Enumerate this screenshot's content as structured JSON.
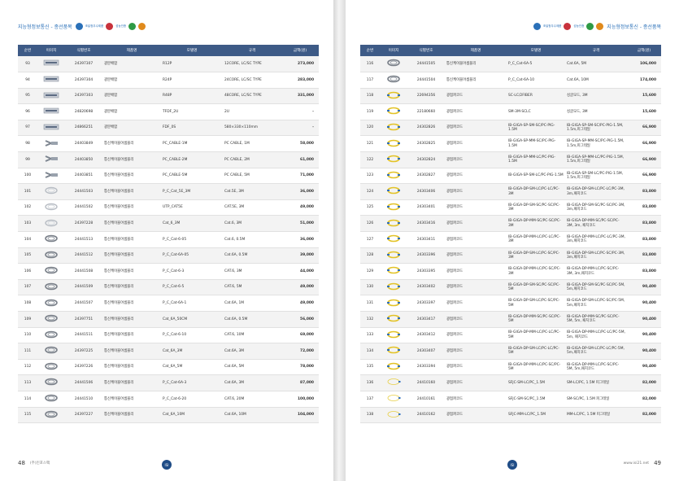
{
  "left": {
    "header_title": "지능형정보통신 - 종선품목",
    "logos": [
      {
        "name": "blue-logo",
        "color": "#2a70b8",
        "text": "조달청우수제품"
      },
      {
        "name": "red-blue-logo",
        "color": "#c8323c",
        "text": "성능인증"
      },
      {
        "name": "green-logo",
        "color": "#2f9a45",
        "text": ""
      },
      {
        "name": "orange-logo",
        "color": "#e08a1c",
        "text": ""
      }
    ],
    "columns": [
      "순번",
      "이미지",
      "식별번호",
      "제품명",
      "모델명",
      "규격",
      "금액(원)"
    ],
    "rows": [
      {
        "no": "93",
        "img": "rack",
        "code": "24397307",
        "name": "광분배함",
        "model": "R12P",
        "spec": "12CORE, LC/SC TYPE",
        "price": "273,000"
      },
      {
        "no": "94",
        "img": "rack",
        "code": "24397304",
        "name": "광분배함",
        "model": "R24P",
        "spec": "24CORE, LC/SC TYPE",
        "price": "283,000"
      },
      {
        "no": "95",
        "img": "rack",
        "code": "24397303",
        "name": "광분배함",
        "model": "R48P",
        "spec": "48CORE, LC/SC TYPE",
        "price": "331,000"
      },
      {
        "no": "96",
        "img": "rack",
        "code": "24820698",
        "name": "광분배함",
        "model": "TFDF_2U",
        "spec": "2U",
        "price": "-"
      },
      {
        "no": "97",
        "img": "rack",
        "code": "24866251",
        "name": "광분배함",
        "model": "FDF_0S",
        "spec": "580×330×110mm",
        "price": "-"
      },
      {
        "no": "98",
        "img": "gray-cable",
        "code": "24403849",
        "name": "통신케이블어셈블리",
        "model": "PC_CABLE-1M",
        "spec": "PC CABLE, 1M",
        "price": "58,000"
      },
      {
        "no": "99",
        "img": "gray-cable",
        "code": "24403850",
        "name": "통신케이블어셈블리",
        "model": "PC_CABLE-2M",
        "spec": "PC CABLE, 2M",
        "price": "61,000"
      },
      {
        "no": "100",
        "img": "gray-cable",
        "code": "24403851",
        "name": "통신케이블어셈블리",
        "model": "PC_CABLE-5M",
        "spec": "PC CABLE, 5M",
        "price": "71,000"
      },
      {
        "no": "101",
        "img": "white-coil",
        "code": "24441503",
        "name": "통신케이블어셈블리",
        "model": "P_C_Cat_5E_3M",
        "spec": "Cat.5E, 3M",
        "price": "36,000"
      },
      {
        "no": "102",
        "img": "white-coil",
        "code": "24441502",
        "name": "통신케이블어셈블리",
        "model": "UTP_CAT5E",
        "spec": "CAT.5E, 3M",
        "price": "49,000"
      },
      {
        "no": "103",
        "img": "white-coil",
        "code": "24397228",
        "name": "통신케이블어셈블리",
        "model": "Cat_6_3M",
        "spec": "Cat.6, 3M",
        "price": "51,000"
      },
      {
        "no": "104",
        "img": "gray-coil",
        "code": "24441513",
        "name": "통신케이블어셈블리",
        "model": "P_C_Cat-6-05",
        "spec": "Cat.6, 0.5M",
        "price": "36,000"
      },
      {
        "no": "105",
        "img": "gray-coil",
        "code": "24441512",
        "name": "통신케이블어셈블리",
        "model": "P_C_Cat-6A-05",
        "spec": "Cat.6A, 0.5M",
        "price": "39,000"
      },
      {
        "no": "106",
        "img": "gray-coil",
        "code": "24441508",
        "name": "통신케이블어셈블리",
        "model": "P_C_Cat-6-3",
        "spec": "CAT.6, 3M",
        "price": "44,000"
      },
      {
        "no": "107",
        "img": "gray-coil",
        "code": "24441509",
        "name": "통신케이블어셈블리",
        "model": "P_C_Cat-6-5",
        "spec": "CAT.6, 5M",
        "price": "49,000"
      },
      {
        "no": "108",
        "img": "gray-coil",
        "code": "24441507",
        "name": "통신케이블어셈블리",
        "model": "P_C_Cat-6A-1",
        "spec": "Cat.6A, 1M",
        "price": "49,000"
      },
      {
        "no": "109",
        "img": "gray-coil",
        "code": "24397751",
        "name": "통신케이블어셈블리",
        "model": "Cat_6A_50CM",
        "spec": "Cat.6A, 0.5M",
        "price": "56,000"
      },
      {
        "no": "110",
        "img": "gray-coil",
        "code": "24441511",
        "name": "통신케이블어셈블리",
        "model": "P_C_Cat-6-10",
        "spec": "CAT.6, 10M",
        "price": "69,000"
      },
      {
        "no": "111",
        "img": "gray-coil",
        "code": "24397225",
        "name": "통신케이블어셈블리",
        "model": "Cat_6A_3M",
        "spec": "Cat.6A, 3M",
        "price": "72,000"
      },
      {
        "no": "112",
        "img": "gray-coil",
        "code": "24397226",
        "name": "통신케이블어셈블리",
        "model": "Cat_6A_5M",
        "spec": "Cat.6A, 5M",
        "price": "78,000"
      },
      {
        "no": "113",
        "img": "gray-coil",
        "code": "24441506",
        "name": "통신케이블어셈블리",
        "model": "P_C_Cat-6A-3",
        "spec": "Cat.6A, 3M",
        "price": "87,000"
      },
      {
        "no": "114",
        "img": "gray-coil",
        "code": "24441510",
        "name": "통신케이블어셈블리",
        "model": "P_C_Cat-6-20",
        "spec": "CAT.6, 20M",
        "price": "100,000"
      },
      {
        "no": "115",
        "img": "gray-coil",
        "code": "24397227",
        "name": "통신케이블어셈블리",
        "model": "Cat_6A_10M",
        "spec": "Cat.6A, 10M",
        "price": "104,000"
      }
    ],
    "page_number": "48",
    "company": "(주)인포스팩",
    "corner_logo_text": "ISI"
  },
  "right": {
    "header_title": "지능형정보통신 - 종선품목",
    "logos": [
      {
        "name": "blue-logo",
        "color": "#2a70b8",
        "text": "조달청우수제품"
      },
      {
        "name": "red-blue-logo",
        "color": "#c8323c",
        "text": "성능인증"
      },
      {
        "name": "green-logo",
        "color": "#2f9a45",
        "text": ""
      },
      {
        "name": "orange-logo",
        "color": "#e08a1c",
        "text": ""
      }
    ],
    "columns": [
      "순번",
      "이미지",
      "식별번호",
      "제품명",
      "모델명",
      "규격",
      "금액(원)"
    ],
    "rows": [
      {
        "no": "116",
        "img": "gray-coil",
        "code": "24441505",
        "name": "통신케이블어셈블리",
        "model": "P_C_Cat-6A-5",
        "spec": "Cat.6A, 5M",
        "price": "106,000"
      },
      {
        "no": "117",
        "img": "gray-coil",
        "code": "24441504",
        "name": "통신케이블어셈블리",
        "model": "P_C_Cat-6A-10",
        "spec": "Cat.6A, 10M",
        "price": "174,000"
      },
      {
        "no": "118",
        "img": "yellow-coil",
        "code": "22694356",
        "name": "광점퍼코드",
        "model": "SC-LC/2FIBER",
        "spec": "싱글모드, 3M",
        "price": "15,600"
      },
      {
        "no": "119",
        "img": "yellow-coil",
        "code": "22180660",
        "name": "광점퍼코드",
        "model": "SM-3M-SCLC",
        "spec": "싱글모드, 3M",
        "price": "15,600"
      },
      {
        "no": "120",
        "img": "yellow-coil",
        "code": "24302826",
        "name": "광점퍼코드",
        "model": "IB-GIGA-SP-SM-SC/PC-PIG-1.5M",
        "spec": "IB-GIGA-SP-SM-SC/PC-PIG-1.5M, 1.5m,피그테일",
        "price": "66,900"
      },
      {
        "no": "121",
        "img": "yellow-coil",
        "code": "24302825",
        "name": "광점퍼코드",
        "model": "IB-GIGA-SP-MM-SC/PC-PIG-1.5M",
        "spec": "IB-GIGA-SP-MM-SC/PC-PIG-1.5M, 1.5m,피그테일",
        "price": "66,900"
      },
      {
        "no": "122",
        "img": "yellow-coil",
        "code": "24302824",
        "name": "광점퍼코드",
        "model": "IB-GIGA-SP-MM-LC/PC-PIG-1.5M",
        "spec": "IB-GIGA-SP-MM-LC/PC-PIG-1.5M, 1.5m,피그테일",
        "price": "66,900"
      },
      {
        "no": "123",
        "img": "yellow-coil",
        "code": "24302827",
        "name": "광점퍼코드",
        "model": "IB-GIGA-SP-SM-LC/PC-PIG-1.5M",
        "spec": "IB-GIGA-SP-SM-LC/PC-PIG-1.5M, 1.5m,피그테일",
        "price": "66,900"
      },
      {
        "no": "124",
        "img": "yellow-coil",
        "code": "24303406",
        "name": "광점퍼코드",
        "model": "IB-GIGA-DP-SM-LC/PC-LC/PC-3M",
        "spec": "IB-GIGA-DP-SM-LC/PC-LC/PC-3M, 3m,패치코드",
        "price": "83,800"
      },
      {
        "no": "125",
        "img": "yellow-coil",
        "code": "24303401",
        "name": "광점퍼코드",
        "model": "IB-GIGA-DP-SM-SC/PC-SC/PC-3M",
        "spec": "IB-GIGA-DP-SM-SC/PC-SC/PC-3M, 3m,패치코드",
        "price": "83,800"
      },
      {
        "no": "126",
        "img": "yellow-coil",
        "code": "24303416",
        "name": "광점퍼코드",
        "model": "IB-GIGA-DP-MM-SC/PC-SC/PC-3M",
        "spec": "IB-GIGA-DP-MM-SC/PC-SC/PC-3M, 3m, 패치코드",
        "price": "83,800"
      },
      {
        "no": "127",
        "img": "yellow-coil",
        "code": "24303411",
        "name": "광점퍼코드",
        "model": "IB-GIGA-DP-MM-LC/PC-LC/PC-3M",
        "spec": "IB-GIGA-DP-MM-LC/PC-LC/PC-3M, 3m,패치코드",
        "price": "83,800"
      },
      {
        "no": "128",
        "img": "yellow-coil",
        "code": "24303396",
        "name": "광점퍼코드",
        "model": "IB-GIGA-DP-SM-LC/PC-SC/PC-3M",
        "spec": "IB-GIGA-DP-SM-LC/PC-SC/PC-3M, 3m,패치코드",
        "price": "83,800"
      },
      {
        "no": "129",
        "img": "yellow-coil",
        "code": "24303395",
        "name": "광점퍼코드",
        "model": "IB-GIGA-DP-MM-LC/PC-SC/PC-3M",
        "spec": "IB-GIGA-DP-MM-LC/PC-SC/PC-3M, 3m,패치코드",
        "price": "83,800"
      },
      {
        "no": "130",
        "img": "yellow-coil",
        "code": "24303402",
        "name": "광점퍼코드",
        "model": "IB-GIGA-DP-SM-SC/PC-SC/PC-5M",
        "spec": "IB-GIGA-DP-SM-SC/PC-SC/PC-5M, 5m,패치코드",
        "price": "90,400"
      },
      {
        "no": "131",
        "img": "yellow-coil",
        "code": "24303397",
        "name": "광점퍼코드",
        "model": "IB-GIGA-DP-SM-LC/PC-SC/PC-5M",
        "spec": "IB-GIGA-DP-SM-LC/PC-SC/PC-5M, 5m,패치코드",
        "price": "90,400"
      },
      {
        "no": "132",
        "img": "yellow-coil",
        "code": "24303417",
        "name": "광점퍼코드",
        "model": "IB-GIGA-DP-MM-SC/PC-SC/PC-5M",
        "spec": "IB-GIGA-DP-MM-SC/PC-SC/PC-5M, 5m, 패치코드",
        "price": "90,400"
      },
      {
        "no": "133",
        "img": "yellow-coil",
        "code": "24303412",
        "name": "광점퍼코드",
        "model": "IB-GIGA-DP-MM-LC/PC-LC/PC-5M",
        "spec": "IB-GIGA-DP-MM-LC/PC-LC/PC-5M, 5m, 패치코드",
        "price": "90,400"
      },
      {
        "no": "134",
        "img": "yellow-coil",
        "code": "24303407",
        "name": "광점퍼코드",
        "model": "IB-GIGA-DP-SM-LC/PC-LC/PC-5M",
        "spec": "IB-GIGA-DP-SM-LC/PC-LC/PC-5M, 5m,패치코드",
        "price": "90,400"
      },
      {
        "no": "135",
        "img": "yellow-coil",
        "code": "24303394",
        "name": "광점퍼코드",
        "model": "IB-GIGA-DP-MM-LC/PC-SC/PC-5M",
        "spec": "IB-GIGA-DP-MM-LC/PC-SC/PC-5M, 5m,패치코드",
        "price": "90,400"
      },
      {
        "no": "136",
        "img": "yellow-thin",
        "code": "24410160",
        "name": "광점퍼코드",
        "model": "SFJC-SM-LC/PC_1.5M",
        "spec": "SM-LC/PC, 1.5M 피그테일",
        "price": "82,000"
      },
      {
        "no": "137",
        "img": "yellow-thin",
        "code": "24410161",
        "name": "광점퍼코드",
        "model": "SFJC-SM-SC/PC_1.5M",
        "spec": "SM-SC/PC, 1.5M 피그테일",
        "price": "82,000"
      },
      {
        "no": "138",
        "img": "yellow-thin",
        "code": "24410162",
        "name": "광점퍼코드",
        "model": "SFJC-MM-LC/PC_1.5M",
        "spec": "MM-LC/PC, 1.5M 피그테일",
        "price": "82,000"
      }
    ],
    "page_number": "49",
    "site": "www.isi21.net",
    "corner_logo_text": "ISI"
  }
}
